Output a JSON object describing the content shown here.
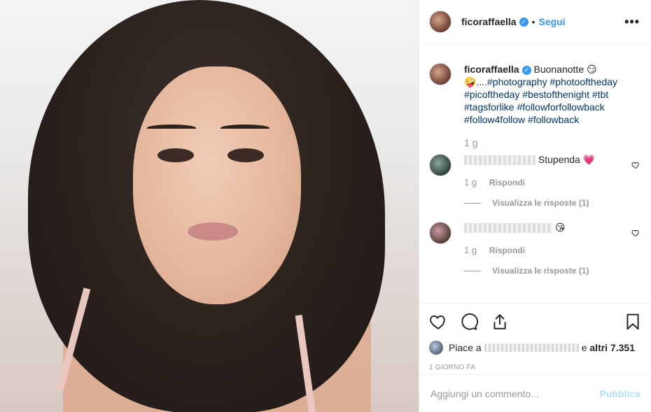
{
  "post": {
    "username": "ficoraffaella",
    "verified_mark": "✓",
    "separator": "•",
    "follow_label": "Segui",
    "more_label": "•••"
  },
  "caption": {
    "username": "ficoraffaella",
    "text_intro": " Buonanotte 😏",
    "text_emoji": "🤪....",
    "hashtags": "#photography #photooftheday #picoftheday #bestofthenight #tbt #tagsforlike #followforfollowback #follow4follow #followback",
    "time": "1 g"
  },
  "comments": [
    {
      "text": "Stupenda 💗",
      "time": "1 g",
      "reply_label": "Rispondi",
      "view_replies": "Visualizza le risposte (1)"
    },
    {
      "text": "😘",
      "time": "1 g",
      "reply_label": "Rispondi",
      "view_replies": "Visualizza le risposte (1)"
    }
  ],
  "likes": {
    "prefix": "Piace a",
    "suffix": "e",
    "count_text": "altri 7.351"
  },
  "timestamp": "1 GIORNO FA",
  "add_comment": {
    "placeholder": "Aggiungi un commento...",
    "publish_label": "Pubblica"
  },
  "colors": {
    "accent": "#3897f0",
    "hashtag": "#003569",
    "muted": "#999999",
    "publish_disabled": "#b2dffc"
  },
  "icons": [
    "heart-icon",
    "comment-icon",
    "share-icon",
    "bookmark-icon",
    "verified-icon",
    "more-icon"
  ]
}
